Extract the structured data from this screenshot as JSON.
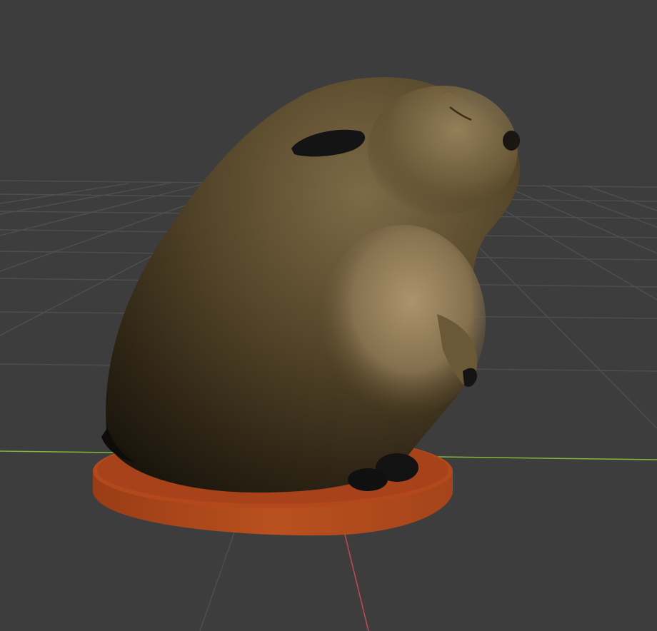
{
  "viewport": {
    "mode": "3d-viewport",
    "background_color": "#3d3d3d",
    "grid_color": "#4c4c4c",
    "x_axis_color": "#c4465a",
    "y_axis_color": "#7fb83a"
  },
  "scene": {
    "subject": "hamster-figurine-model",
    "fur_color": "#5a4a2e",
    "belly_fur_color": "#a08a62",
    "paw_color": "#121212",
    "base_color": "#b54a1e"
  }
}
